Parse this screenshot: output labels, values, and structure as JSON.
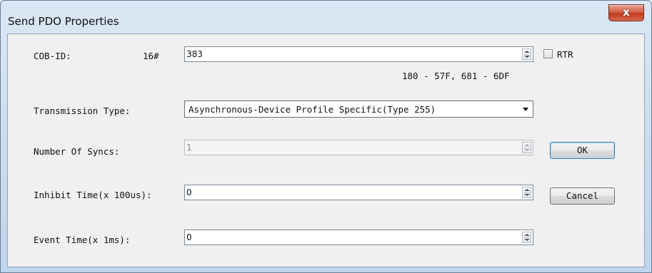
{
  "window": {
    "title": "Send PDO Properties",
    "close_label": "x"
  },
  "cob_id": {
    "label": "COB-ID:",
    "prefix": "16#",
    "value": "383",
    "range_hint": "180 - 57F, 681 - 6DF",
    "rtr_label": "RTR",
    "rtr_checked": false
  },
  "transmission": {
    "label": "Transmission Type:",
    "selected": "Asynchronous-Device Profile Specific(Type 255)"
  },
  "syncs": {
    "label": "Number Of Syncs:",
    "value": "1",
    "enabled": false
  },
  "inhibit": {
    "label": "Inhibit Time(x 100us):",
    "value": "0"
  },
  "event": {
    "label": "Event Time(x 1ms):",
    "value": "0"
  },
  "buttons": {
    "ok": "OK",
    "cancel": "Cancel"
  }
}
